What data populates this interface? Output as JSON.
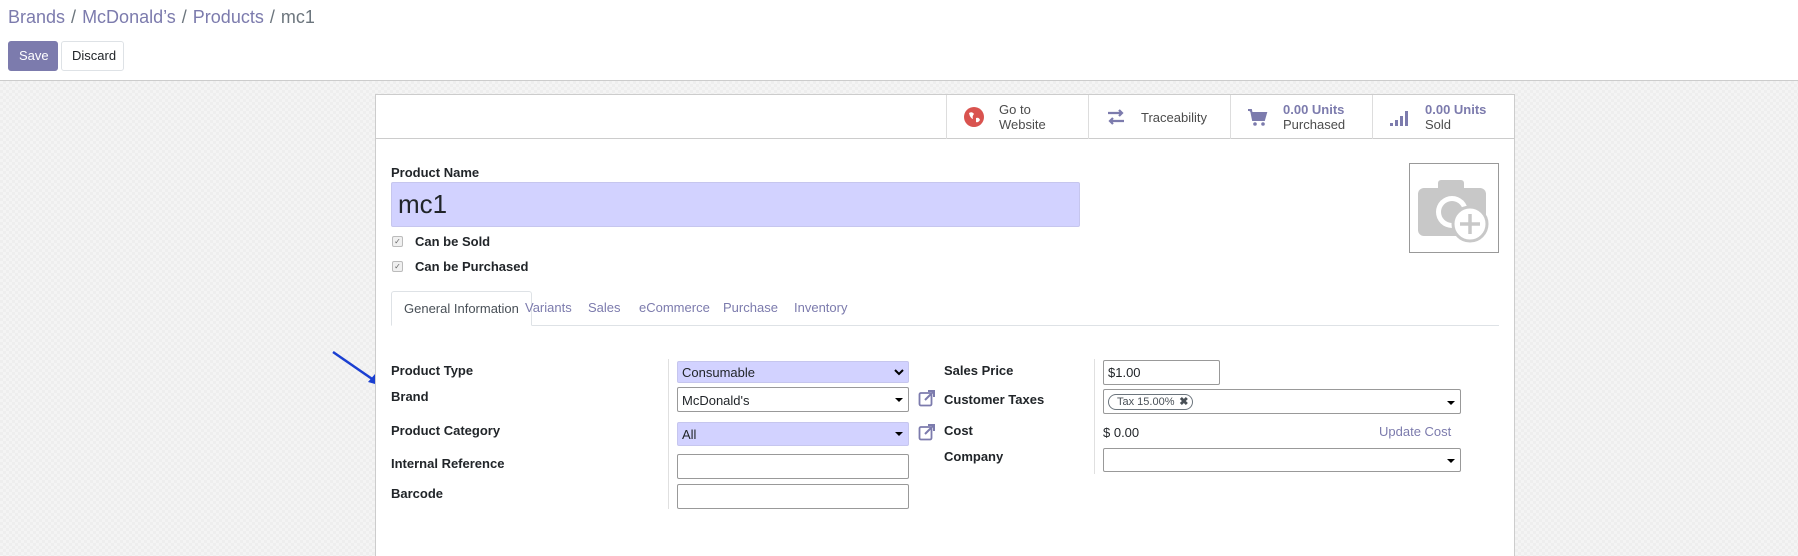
{
  "breadcrumb": [
    {
      "label": "Brands"
    },
    {
      "label": "McDonald’s"
    },
    {
      "label": "Products"
    }
  ],
  "breadcrumb_active": "mc1",
  "buttons": {
    "save": "Save",
    "discard": "Discard"
  },
  "stat_buttons": {
    "website": {
      "line1": "Go to",
      "line2": "Website"
    },
    "traceability": {
      "label": "Traceability"
    },
    "purchased": {
      "value": "0.00 Units",
      "label": "Purchased"
    },
    "sold": {
      "value": "0.00 Units",
      "label": "Sold"
    }
  },
  "product": {
    "name_label": "Product Name",
    "name_value": "mc1",
    "can_be_sold_label": "Can be Sold",
    "can_be_purchased_label": "Can be Purchased"
  },
  "tabs": [
    "General Information",
    "Variants",
    "Sales",
    "eCommerce",
    "Purchase",
    "Inventory"
  ],
  "left_fields": {
    "product_type": {
      "label": "Product Type",
      "value": "Consumable"
    },
    "brand": {
      "label": "Brand",
      "value": "McDonald's"
    },
    "product_category": {
      "label": "Product Category",
      "value": "All"
    },
    "internal_reference": {
      "label": "Internal Reference",
      "value": ""
    },
    "barcode": {
      "label": "Barcode",
      "value": ""
    }
  },
  "right_fields": {
    "sales_price": {
      "label": "Sales Price",
      "value": "$1.00"
    },
    "customer_taxes": {
      "label": "Customer Taxes",
      "tag": "Tax 15.00%"
    },
    "cost": {
      "label": "Cost",
      "value": "$ 0.00",
      "action": "Update Cost"
    },
    "company": {
      "label": "Company",
      "value": ""
    }
  },
  "colors": {
    "primary": "#7c7bad",
    "required_field": "#d2d2ff",
    "annotation_arrow": "#1a3fd1",
    "website_icon": "#d9534f"
  }
}
